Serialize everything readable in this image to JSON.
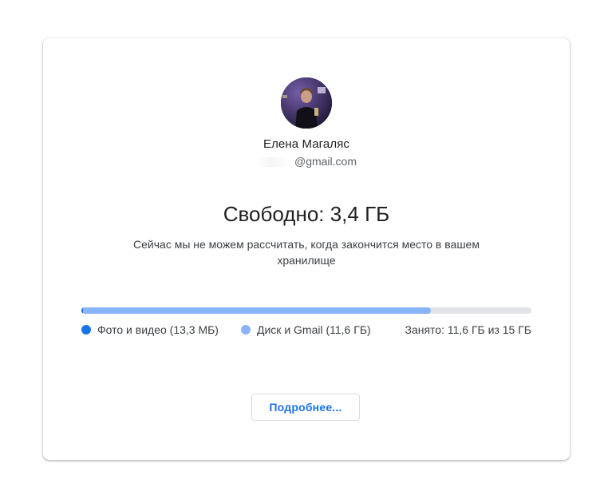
{
  "account": {
    "name": "Елена Магаляс",
    "email_domain": "@gmail.com"
  },
  "storage": {
    "free_title": "Свободно: 3,4 ГБ",
    "description": "Сейчас мы не можем рассчитать, когда закончится место в вашем хранилище",
    "photos_fraction": 0.0009,
    "drive_gmail_fraction": 0.773,
    "legend": {
      "photos_label": "Фото и видео (13,3 МБ)",
      "drive_label": "Диск и Gmail (11,6 ГБ)",
      "used_total": "Занято: 11,6 ГБ из 15 ГБ"
    }
  },
  "actions": {
    "details_label": "Подробнее..."
  },
  "colors": {
    "photos": "#1a73e8",
    "drive_gmail": "#8ab4f8",
    "track": "#e3e4e8"
  }
}
